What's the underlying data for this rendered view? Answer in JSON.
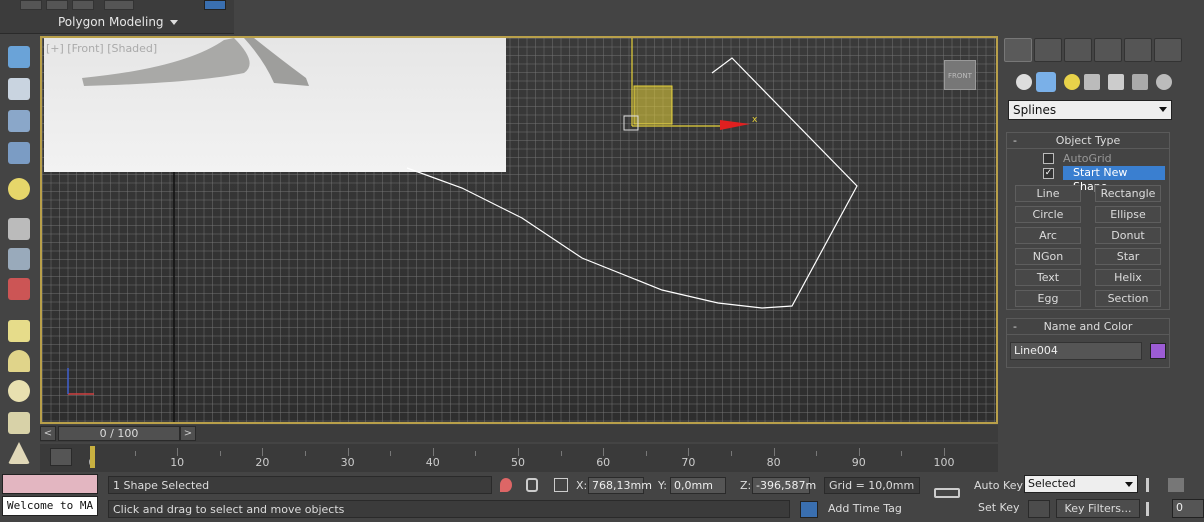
{
  "ribbon": {
    "tab_label": "Polygon Modeling"
  },
  "viewport": {
    "label": "[+] [Front] [Shaded]",
    "spline_color": "#ffffff",
    "gizmo_color": "#e6d23a",
    "x_axis_label": "x",
    "viewcube_label": "FRONT"
  },
  "command_panel": {
    "category_dropdown": "Splines",
    "object_type_header": "Object Type",
    "autogrid_label": "AutoGrid",
    "start_new_shape_label": "Start New Shape",
    "shape_buttons": [
      "Line",
      "Rectangle",
      "Circle",
      "Ellipse",
      "Arc",
      "Donut",
      "NGon",
      "Star",
      "Text",
      "Helix",
      "Egg",
      "Section"
    ],
    "name_color_header": "Name and Color",
    "object_name": "Line004",
    "object_color": "#9c5cd4"
  },
  "timeline": {
    "frame_display": "0 / 100",
    "prev_label": "<",
    "next_label": ">",
    "ruler_labels": [
      "0",
      "10",
      "20",
      "30",
      "40",
      "50",
      "60",
      "70",
      "80",
      "90",
      "100"
    ]
  },
  "status": {
    "selection_status": "1 Shape Selected",
    "prompt": "Click and drag to select and move objects",
    "welcome": "Welcome to MA",
    "x_label": "X:",
    "x_value": "768,13mm",
    "y_label": "Y:",
    "y_value": "0,0mm",
    "z_label": "Z:",
    "z_value": "-396,587m",
    "grid": "Grid = 10,0mm",
    "add_time_tag": "Add Time Tag",
    "auto_key": "Auto Key",
    "set_key": "Set Key",
    "key_mode_value": "Selected",
    "key_filters": "Key Filters...",
    "current_frame": "0"
  }
}
